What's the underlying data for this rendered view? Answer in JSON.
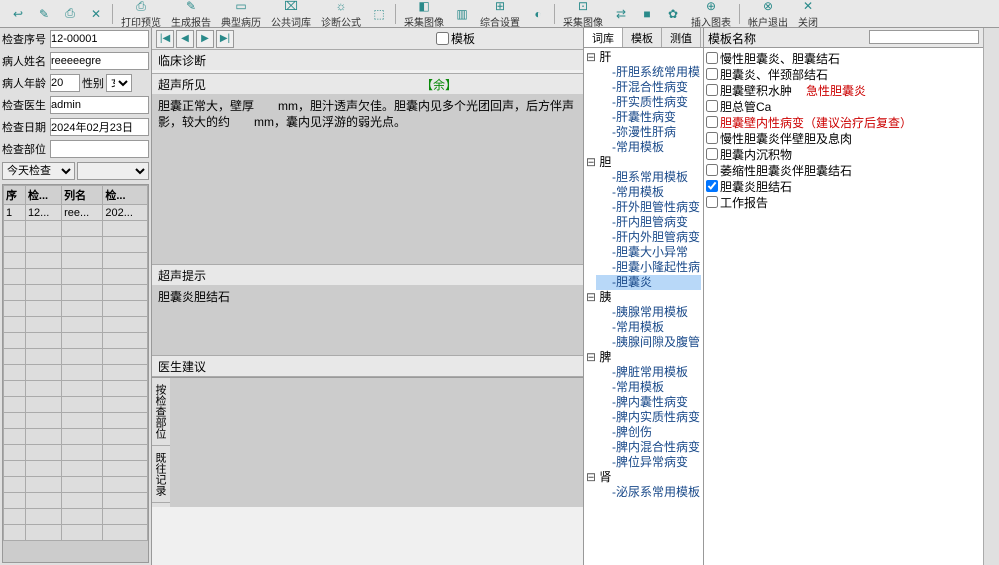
{
  "toolbar": {
    "groups": [
      [
        {
          "icon": "↩",
          "label": ""
        },
        {
          "icon": "✎",
          "label": ""
        },
        {
          "icon": "⎙",
          "label": ""
        },
        {
          "icon": "✕",
          "label": ""
        }
      ],
      [
        {
          "icon": "⎙",
          "label": "打印预览"
        },
        {
          "icon": "✎",
          "label": "生成报告"
        },
        {
          "icon": "▭",
          "label": "典型病历"
        },
        {
          "icon": "⌧",
          "label": "公共词库"
        },
        {
          "icon": "☼",
          "label": "诊断公式"
        },
        {
          "icon": "⬚",
          "label": ""
        }
      ],
      [
        {
          "icon": "◧",
          "label": "采集图像"
        },
        {
          "icon": "▥",
          "label": ""
        },
        {
          "icon": "⊞",
          "label": "综合设置"
        },
        {
          "icon": "◐",
          "label": ""
        }
      ],
      [
        {
          "icon": "⊡",
          "label": "采集图像"
        },
        {
          "icon": "⇄",
          "label": ""
        },
        {
          "icon": "■",
          "label": ""
        },
        {
          "icon": "✿",
          "label": ""
        },
        {
          "icon": "⊕",
          "label": "插入图表"
        }
      ],
      [
        {
          "icon": "⊗",
          "label": "帐户退出"
        },
        {
          "icon": "✕",
          "label": "关闭"
        }
      ]
    ]
  },
  "form": {
    "exam_no_label": "检查序号",
    "exam_no": "12-00001",
    "name_label": "病人姓名",
    "name": "reeeeegre",
    "age_label": "病人年龄",
    "age": "20",
    "sex_label": "性别",
    "sex": "女",
    "doctor_label": "检查医生",
    "doctor": "admin",
    "date_label": "检查日期",
    "date": "2024年02月23日",
    "part_label": "检查部位",
    "part": "",
    "filter": "今天检查"
  },
  "grid": {
    "headers": [
      "序",
      "检...",
      "列名",
      "检..."
    ],
    "rows": [
      [
        "1",
        "12...",
        "ree...",
        "202..."
      ]
    ]
  },
  "nav": {
    "template_cb": "模板"
  },
  "sections": {
    "diagnosis_title": "临床诊断",
    "finding_title": "超声所见",
    "finding_link": "【余】",
    "finding_body": "胆囊正常大，壁厚　　mm，胆汁透声欠佳。胆囊内见多个光团回声，后方伴声影，较大的约　　mm，囊内见浮游的弱光点。",
    "hint_title": "超声提示",
    "hint_body": "胆囊炎胆结石",
    "advice_title": "医生建议"
  },
  "vtabs": [
    "按检查部位",
    "既往记录"
  ],
  "tabs": [
    "词库",
    "模板",
    "测值"
  ],
  "tree": [
    {
      "label": "肝",
      "expanded": true,
      "children": [
        {
          "leaf": "肝胆系统常用模"
        },
        {
          "leaf": "肝混合性病变"
        },
        {
          "leaf": "肝实质性病变"
        },
        {
          "leaf": "肝囊性病变"
        },
        {
          "leaf": "弥漫性肝病"
        },
        {
          "leaf": "常用模板"
        }
      ]
    },
    {
      "label": "胆",
      "expanded": true,
      "children": [
        {
          "leaf": "胆系常用模板"
        },
        {
          "leaf": "常用模板"
        },
        {
          "leaf": "肝外胆管性病变"
        },
        {
          "leaf": "肝内胆管病变"
        },
        {
          "leaf": "肝内外胆管病变"
        },
        {
          "leaf": "胆囊大小异常"
        },
        {
          "leaf": "胆囊小隆起性病"
        },
        {
          "leaf": "胆囊炎",
          "selected": true
        }
      ]
    },
    {
      "label": "胰",
      "expanded": true,
      "children": [
        {
          "leaf": "胰腺常用模板"
        },
        {
          "leaf": "常用模板"
        },
        {
          "leaf": "胰腺间隙及腹管"
        }
      ]
    },
    {
      "label": "脾",
      "expanded": true,
      "children": [
        {
          "leaf": "脾脏常用模板"
        },
        {
          "leaf": "常用模板"
        },
        {
          "leaf": "脾内囊性病变"
        },
        {
          "leaf": "脾内实质性病变"
        },
        {
          "leaf": "脾创伤"
        },
        {
          "leaf": "脾内混合性病变"
        },
        {
          "leaf": "脾位异常病变"
        }
      ]
    },
    {
      "label": "肾",
      "expanded": true,
      "children": [
        {
          "leaf": "泌尿系常用模板"
        }
      ]
    }
  ],
  "checks_header": "模板名称",
  "checks": [
    {
      "label": "慢性胆囊炎、胆囊结石",
      "checked": false
    },
    {
      "label": "胆囊炎、伴颈部结石",
      "checked": false
    },
    {
      "label": "胆囊壁积水肿",
      "sub": "急性胆囊炎",
      "checked": false
    },
    {
      "label": "胆总管Ca",
      "checked": false
    },
    {
      "label": "胆囊壁内性病变（建议治疗后复查）",
      "checked": false,
      "red": true
    },
    {
      "label": "慢性胆囊炎伴壁胆及息肉",
      "checked": false
    },
    {
      "label": "胆囊内沉积物",
      "checked": false
    },
    {
      "label": "萎缩性胆囊炎伴胆囊结石",
      "checked": false
    },
    {
      "label": "胆囊炎胆结石",
      "checked": true
    },
    {
      "label": "工作报告",
      "checked": false
    }
  ]
}
